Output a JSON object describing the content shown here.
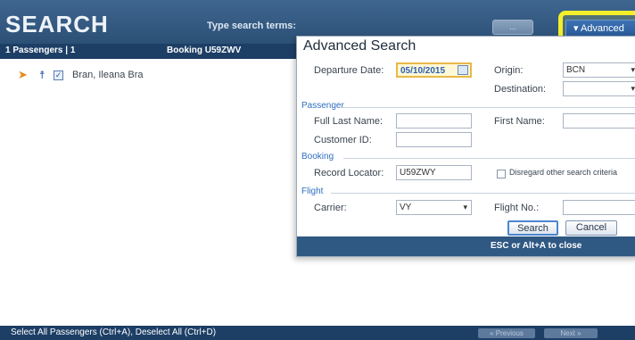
{
  "header": {
    "title": "SEARCH",
    "hint": "Type search terms:",
    "filter_label": "...",
    "advanced_label": "▾ Advanced"
  },
  "subbar": {
    "passengers": "1   Passengers | 1",
    "booking": "Booking U59ZWV"
  },
  "passenger": {
    "name": "Bran, Ileana Bra"
  },
  "dialog": {
    "title": "Advanced Search",
    "departure_date_label": "Departure Date:",
    "departure_date_value": "05/10/2015",
    "origin_label": "Origin:",
    "origin_value": "BCN",
    "destination_label": "Destination:",
    "destination_value": "",
    "section_passenger": "Passenger",
    "full_last_name_label": "Full Last Name:",
    "first_name_label": "First Name:",
    "customer_id_label": "Customer ID:",
    "section_booking": "Booking",
    "record_locator_label": "Record Locator:",
    "record_locator_value": "U59ZWY",
    "disregard_label": "Disregard other search criteria",
    "section_flight": "Flight",
    "carrier_label": "Carrier:",
    "carrier_value": "VY",
    "flight_no_label": "Flight No.:",
    "search_button": "Search",
    "cancel_button": "Cancel",
    "footer_hint": "ESC or Alt+A to close"
  },
  "bottom": {
    "hint": "Select All Passengers (Ctrl+A), Deselect All (Ctrl+D)",
    "previous": "« Previous",
    "next": "Next »"
  },
  "colors": {
    "header": "#2c5076",
    "highlight": "#f2ee2a",
    "accent": "#2a5a96"
  }
}
